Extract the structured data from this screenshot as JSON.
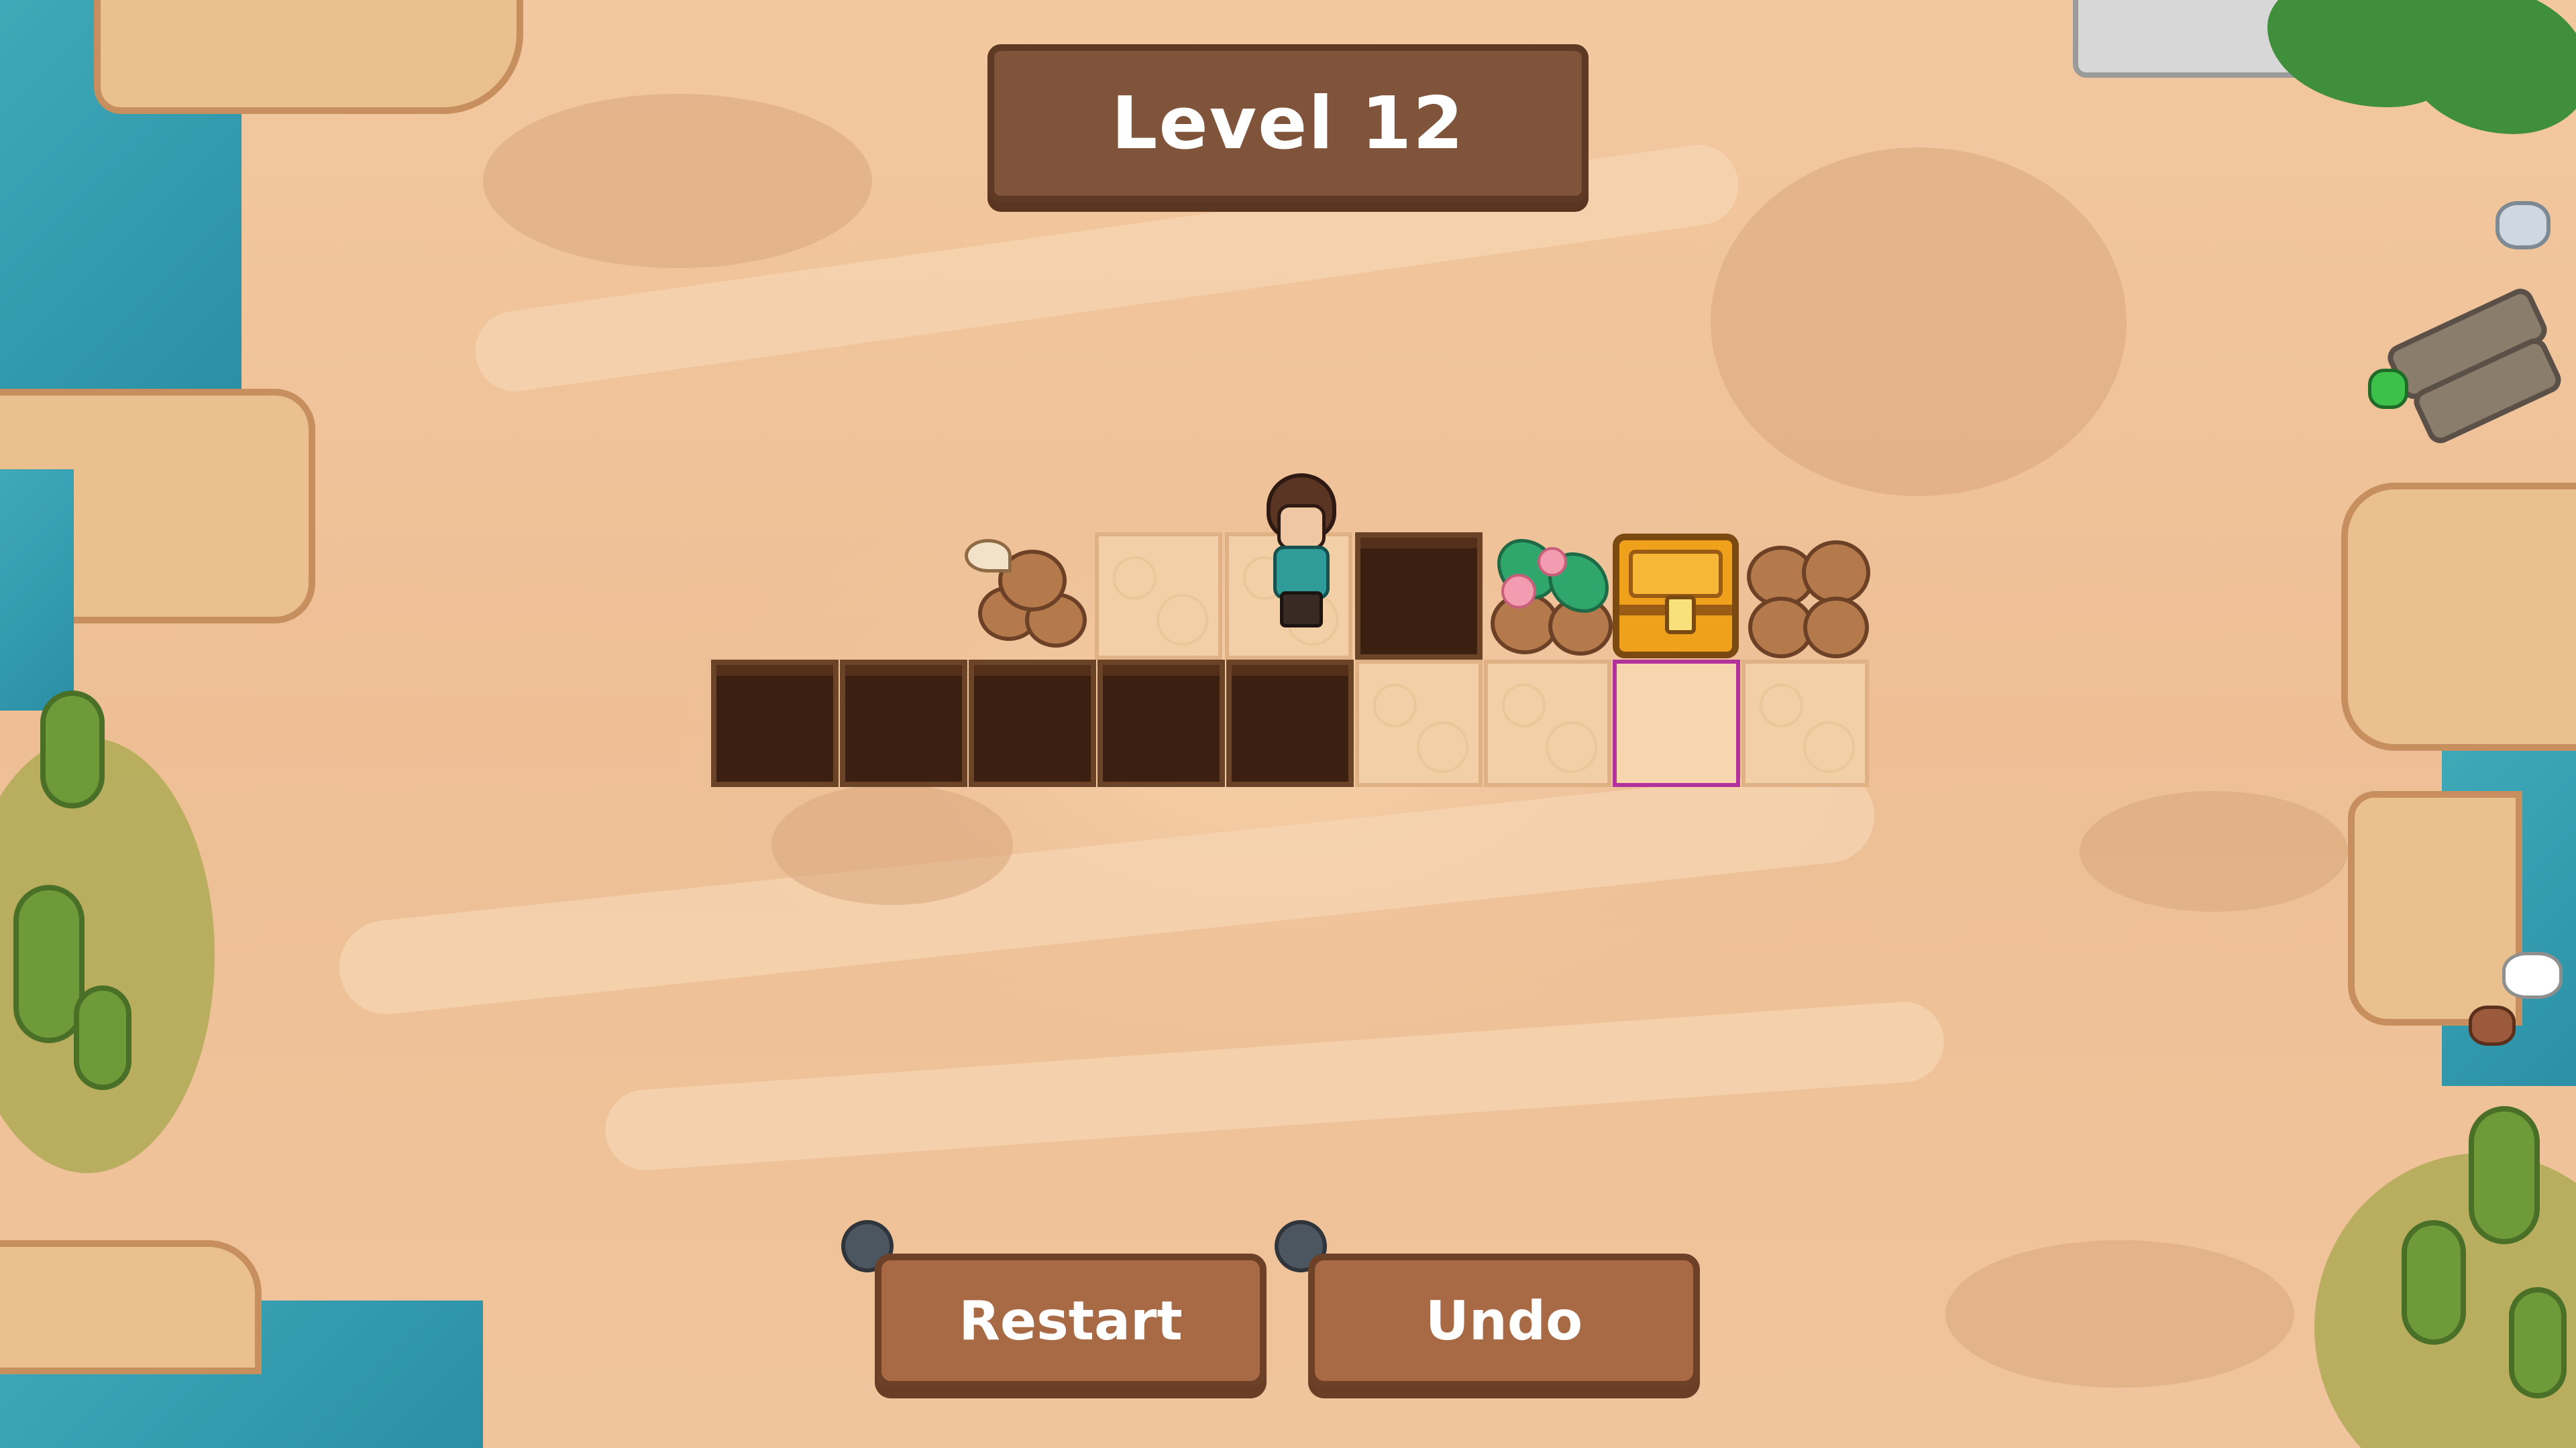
{
  "header": {
    "level_title": "Level 12"
  },
  "board": {
    "rows": [
      [
        "bull-rock",
        "sand",
        "hero",
        "pit",
        "flower-rock",
        "treasure-chest",
        "rock"
      ],
      [
        "pit",
        "pit",
        "pit",
        "pit",
        "pit",
        "sand",
        "sand",
        "target",
        "sand"
      ]
    ]
  },
  "controls": {
    "restart_label": "Restart",
    "undo_label": "Undo"
  },
  "colors": {
    "sand": "#f2cfa6",
    "pit": "#3b2011",
    "target_outline": "#b3319a",
    "button": "#a86a45",
    "banner": "#80543a",
    "chest": "#f0a11c",
    "water": "#3fa9b8"
  },
  "icons": {
    "restart_hint": "gamepad-button-dot",
    "undo_hint": "gamepad-button-dot"
  }
}
